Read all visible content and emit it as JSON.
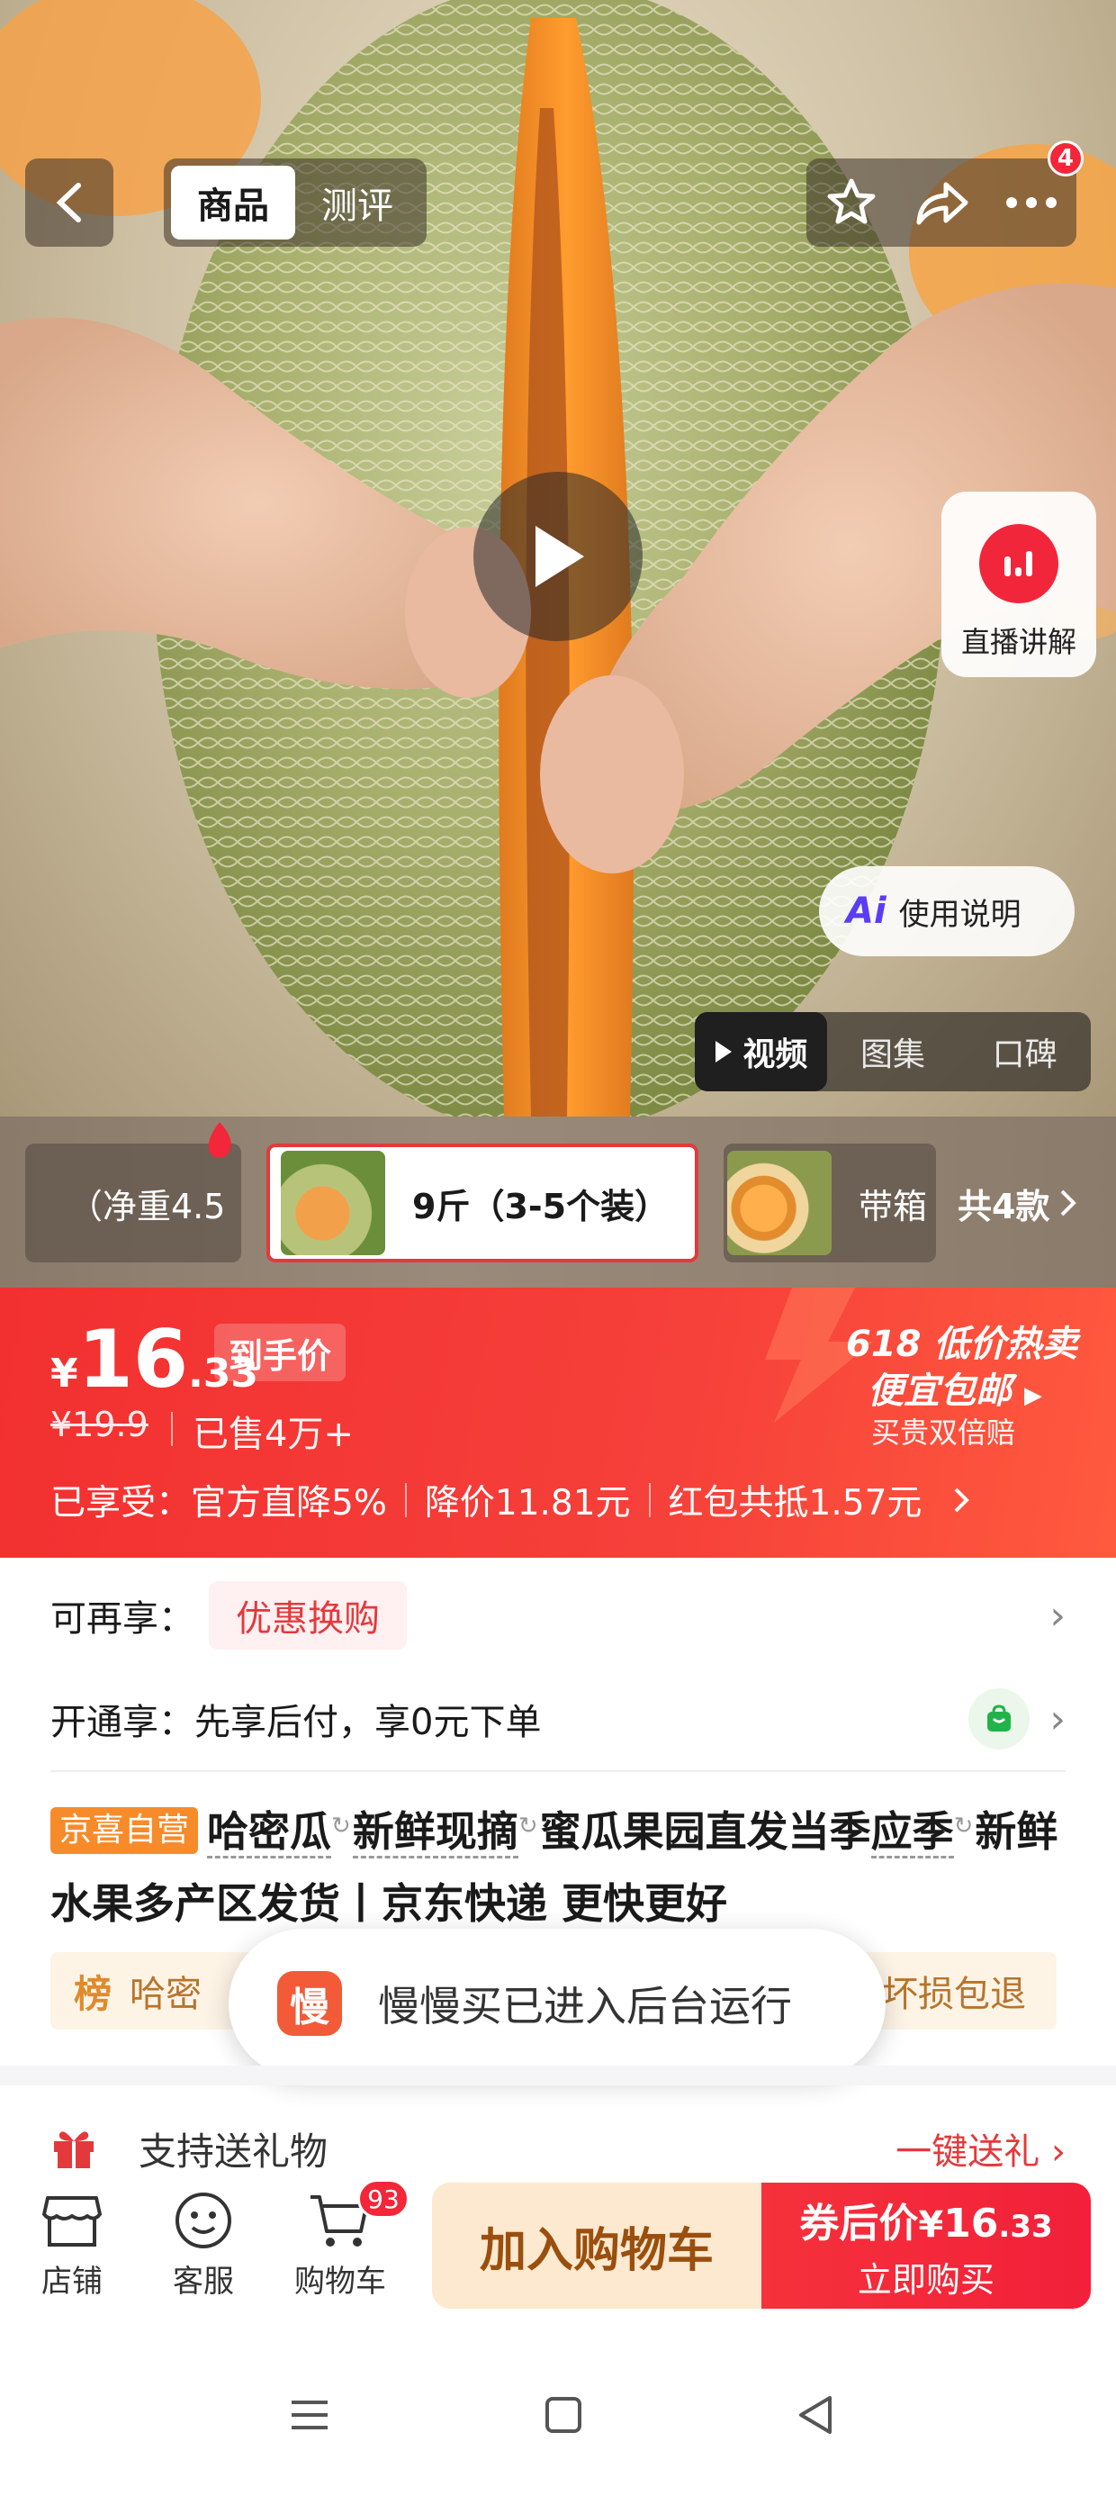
{
  "header": {
    "tabs": [
      {
        "label": "商品",
        "active": true
      },
      {
        "label": "测评",
        "active": false
      }
    ],
    "more_badge": "4"
  },
  "hero": {
    "live_label": "直播讲解",
    "live_icon": "live-bars-icon",
    "guide_label": "使用说明",
    "guide_icon_text": "Ai",
    "media_tabs": [
      {
        "label": "视频",
        "active": true
      },
      {
        "label": "图集",
        "active": false
      },
      {
        "label": "口碑",
        "active": false
      }
    ]
  },
  "skus": {
    "items": [
      {
        "label": "（净重4.5"
      },
      {
        "label": "9斤（3-5个装）",
        "selected": true
      },
      {
        "label": "带箱"
      }
    ],
    "count_label": "共4款"
  },
  "price": {
    "currency": "¥",
    "integer": "16",
    "decimal": ".33",
    "final_tag": "到手价",
    "original": "¥19.9",
    "sold": "已售4万+",
    "enjoy_prefix": "已享受：",
    "discounts": [
      "官方直降5%",
      "降价11.81元",
      "红包共抵1.57元"
    ],
    "promo_title": "618 低价热卖",
    "promo_free_shipping": "便宜包邮",
    "promo_guarantee": "买贵双倍赔"
  },
  "offers": {
    "more_label": "可再享：",
    "coupon": "优惠换购",
    "open_label": "开通享：",
    "open_text": "先享后付，享0元下单"
  },
  "product": {
    "tag": "京喜自营",
    "kw1": "哈密瓜",
    "kw2": "新鲜现摘",
    "mid": "蜜瓜果园直发当季",
    "kw3": "应季",
    "rest": "新鲜水果多产区发货丨京东快递 更快更好"
  },
  "rank": {
    "icon_text": "榜",
    "left": "哈密",
    "right": "坏损包退"
  },
  "toast": {
    "icon_text": "慢",
    "message": "慢慢买已进入后台运行"
  },
  "gift": {
    "label": "支持送礼物",
    "link": "一键送礼"
  },
  "bottom_bar": {
    "store": "店铺",
    "service": "客服",
    "cart": "购物车",
    "cart_count": "93",
    "add_to_cart": "加入购物车",
    "buy_prefix": "券后价",
    "buy_currency": "¥",
    "buy_integer": "16",
    "buy_decimal": ".33",
    "buy_now": "立即购买"
  },
  "colors": {
    "brand_red": "#f23030",
    "self_tag": "#f78b2a",
    "cart_bg": "#fde9cf"
  }
}
